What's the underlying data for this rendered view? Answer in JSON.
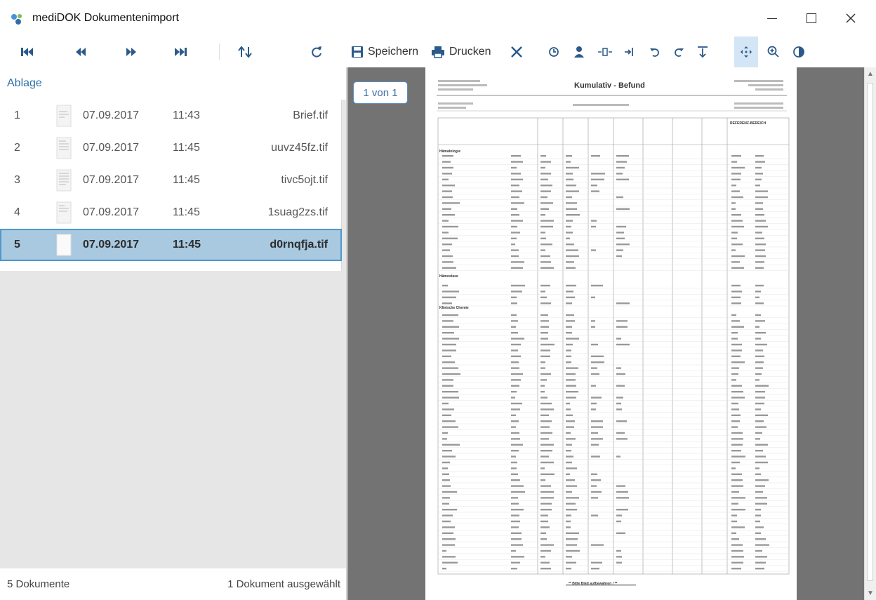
{
  "window": {
    "title": "mediDOK Dokumentenimport"
  },
  "toolbar": {
    "save_label": "Speichern",
    "print_label": "Drucken"
  },
  "left_panel": {
    "header": "Ablage",
    "rows": [
      {
        "num": "1",
        "date": "07.09.2017",
        "time": "11:43",
        "file": "Brief.tif"
      },
      {
        "num": "2",
        "date": "07.09.2017",
        "time": "11:45",
        "file": "uuvz45fz.tif"
      },
      {
        "num": "3",
        "date": "07.09.2017",
        "time": "11:45",
        "file": "tivc5ojt.tif"
      },
      {
        "num": "4",
        "date": "07.09.2017",
        "time": "11:45",
        "file": "1suag2zs.tif"
      },
      {
        "num": "5",
        "date": "07.09.2017",
        "time": "11:45",
        "file": "d0rnqfja.tif"
      }
    ],
    "status_left": "5 Dokumente",
    "status_right": "1 Dokument ausgewählt"
  },
  "viewer": {
    "page_indicator": "1 von 1",
    "document": {
      "title": "Kumulativ - Befund",
      "reference_heading": "REFERENZ-BEREICH",
      "sections": [
        "Hämatologie",
        "Hämostase",
        "Klinische Chemie"
      ],
      "footer": "** Bitte Blatt aufbewahren ! **"
    }
  },
  "colors": {
    "selection_bg": "#a8c9df",
    "selection_border": "#4f97cc",
    "accent": "#2b5a8a",
    "viewer_bg": "#737373"
  }
}
